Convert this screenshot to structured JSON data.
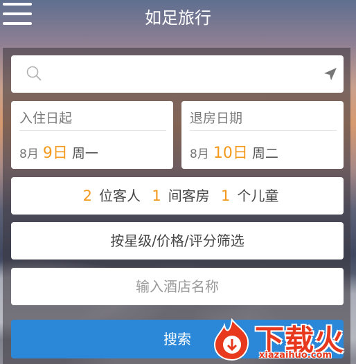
{
  "header": {
    "title": "如足旅行"
  },
  "search": {
    "placeholder": ""
  },
  "checkin": {
    "label": "入住日起",
    "month": "8月",
    "day": "9日",
    "weekday": "周一"
  },
  "checkout": {
    "label": "退房日期",
    "month": "8月",
    "day": "10日",
    "weekday": "周二"
  },
  "guests": {
    "adults": "2",
    "adults_label": "位客人",
    "rooms": "1",
    "rooms_label": "间客房",
    "children": "1",
    "children_label": "个儿童"
  },
  "filter": {
    "label": "按星级/价格/评分筛选"
  },
  "hotel": {
    "placeholder": "输入酒店名称"
  },
  "search_button": {
    "label": "搜索"
  },
  "watermark": {
    "brand": "下载火",
    "url": "xiazaihuo.com"
  },
  "colors": {
    "accent": "#f39a1e",
    "primary": "#2b88d8"
  },
  "icons": {
    "menu": "hamburger-icon",
    "search": "search-icon",
    "location": "location-arrow-icon"
  }
}
